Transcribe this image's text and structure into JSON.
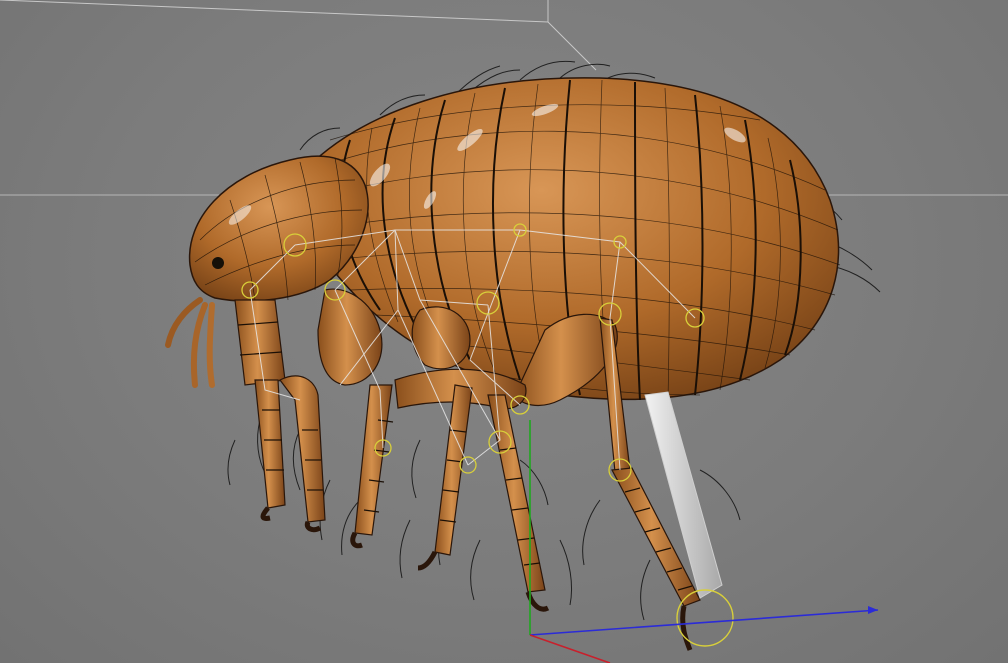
{
  "viewport": {
    "background_color": "#7b7b7b",
    "object": "flea-model",
    "mode": "wireframe-on-shaded",
    "body_color": "#b8742e",
    "wire_color": "#1a0f06",
    "bone_color": "#e8e8e8",
    "joint_color": "#d8cf3a",
    "bone_count": 3
  },
  "axes": {
    "x_color": "#2b2bd8",
    "y_color": "#1fa81f",
    "z_color": "#c8202c"
  },
  "icons": {
    "gizmo": "transform-gizmo-icon",
    "joint": "ik-joint-icon"
  }
}
